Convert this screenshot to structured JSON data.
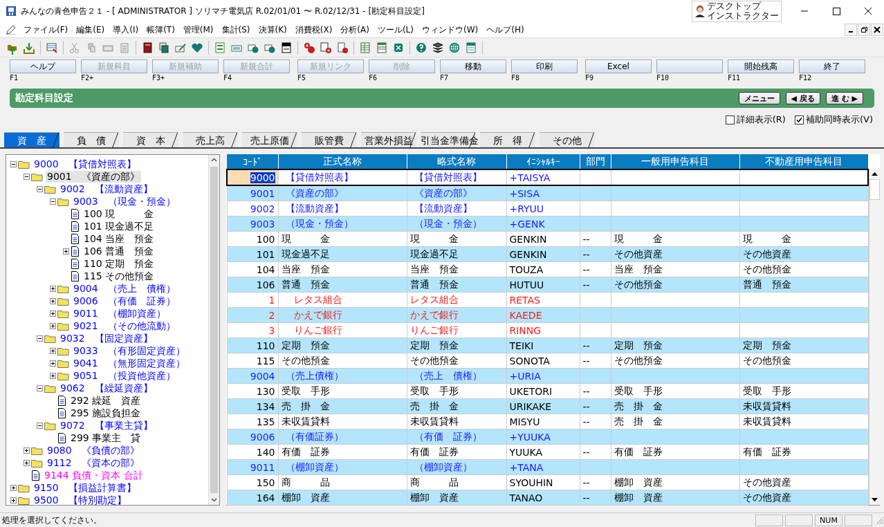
{
  "window": {
    "title": "みんなの青色申告２１ - [ ADMINISTRATOR ] ソリマチ電気店 R.02/01/01 〜 R.02/12/31 - [勘定科目設定]",
    "assistant_badge": [
      "デスクトップ",
      "インストラクター"
    ]
  },
  "menu": [
    "ファイル(F)",
    "編集(E)",
    "導入(I)",
    "帳簿(T)",
    "管理(M)",
    "集計(S)",
    "決算(K)",
    "消費税(X)",
    "分析(A)",
    "ツール(L)",
    "ウィンドウ(W)",
    "ヘルプ(H)"
  ],
  "function_keys": [
    {
      "label": "ヘルプ",
      "key": "F1",
      "disabled": false
    },
    {
      "label": "新規科目",
      "key": "F2+",
      "disabled": true
    },
    {
      "label": "新規補助",
      "key": "F3+",
      "disabled": true
    },
    {
      "label": "新規合計",
      "key": "F4",
      "disabled": true
    },
    {
      "label": "新規リンク",
      "key": "F5",
      "disabled": true
    },
    {
      "label": "削除",
      "key": "F6",
      "disabled": true
    },
    {
      "label": "移動",
      "key": "F7",
      "disabled": false
    },
    {
      "label": "印刷",
      "key": "F8",
      "disabled": false
    },
    {
      "label": "Excel",
      "key": "F9",
      "disabled": false
    },
    {
      "key": "F10"
    },
    {
      "label": "開始残高",
      "key": "F11",
      "disabled": false
    },
    {
      "label": "終了",
      "key": "F12",
      "disabled": false
    }
  ],
  "header": {
    "title": "勘定科目設定",
    "buttons": [
      "メニュー",
      "◀ 戻る",
      "進 む ▶"
    ]
  },
  "options": [
    {
      "label": "詳細表示(R)",
      "checked": false
    },
    {
      "label": "補助同時表示(V)",
      "checked": true
    }
  ],
  "tabs": [
    {
      "label": "資　産",
      "selected": true
    },
    {
      "label": "負　債",
      "selected": false
    },
    {
      "label": "資　本",
      "selected": false
    },
    {
      "label": "売上高",
      "selected": false
    },
    {
      "label": "売上原価",
      "selected": false
    },
    {
      "label": "販管費",
      "selected": false
    },
    {
      "label": "営業外損益",
      "selected": false
    },
    {
      "label": "引当金準備金",
      "selected": false
    },
    {
      "label": "所　得",
      "selected": false
    },
    {
      "label": "その他",
      "selected": false
    }
  ],
  "tree": [
    {
      "label": "9000　【貸借対照表】",
      "kind": "folder",
      "expanded": true,
      "color": "#0000ff",
      "selected": false,
      "children": [
        {
          "label": "9001　《資産の部》",
          "kind": "folder",
          "expanded": true,
          "color": "#000000",
          "selected": true,
          "children": [
            {
              "label": "9002　【流動資産】",
              "kind": "folder",
              "expanded": true,
              "color": "#0000ff",
              "selected": false,
              "children": [
                {
                  "label": "9003　（現金・預金）",
                  "kind": "folder",
                  "expanded": true,
                  "color": "#0000ff",
                  "selected": false,
                  "children": [
                    {
                      "label": "100 現　　　金",
                      "kind": "doc",
                      "color": "#000000",
                      "selected": false
                    },
                    {
                      "label": "101 現金過不足",
                      "kind": "doc",
                      "color": "#000000",
                      "selected": false
                    },
                    {
                      "label": "104 当座　預金",
                      "kind": "doc",
                      "color": "#000000",
                      "selected": false
                    },
                    {
                      "label": "106 普通　預金",
                      "kind": "doc",
                      "expanded": false,
                      "color": "#000000",
                      "selected": false
                    },
                    {
                      "label": "110 定期　預金",
                      "kind": "doc",
                      "color": "#000000",
                      "selected": false
                    },
                    {
                      "label": "115 その他預金",
                      "kind": "doc",
                      "color": "#000000",
                      "selected": false
                    }
                  ]
                },
                {
                  "label": "9004　（売上　債権）",
                  "kind": "folder",
                  "expanded": false,
                  "color": "#0000ff",
                  "selected": false
                },
                {
                  "label": "9006　（有価　証券）",
                  "kind": "folder",
                  "expanded": false,
                  "color": "#0000ff",
                  "selected": false
                },
                {
                  "label": "9011　（棚卸資産）",
                  "kind": "folder",
                  "expanded": false,
                  "color": "#0000ff",
                  "selected": false
                },
                {
                  "label": "9021　（その他流動）",
                  "kind": "folder",
                  "expanded": false,
                  "color": "#0000ff",
                  "selected": false
                }
              ]
            },
            {
              "label": "9032　【固定資産】",
              "kind": "folder",
              "expanded": true,
              "color": "#0000ff",
              "selected": false,
              "children": [
                {
                  "label": "9033　（有形固定資産）",
                  "kind": "folder",
                  "expanded": false,
                  "color": "#0000ff",
                  "selected": false
                },
                {
                  "label": "9041　（無形固定資産）",
                  "kind": "folder",
                  "expanded": false,
                  "color": "#0000ff",
                  "selected": false
                },
                {
                  "label": "9051　（投資他資産）",
                  "kind": "folder",
                  "expanded": false,
                  "color": "#0000ff",
                  "selected": false
                }
              ]
            },
            {
              "label": "9062　【繰延資産】",
              "kind": "folder",
              "expanded": true,
              "color": "#0000ff",
              "selected": false,
              "children": [
                {
                  "label": "292 繰延　資産",
                  "kind": "doc",
                  "color": "#000000",
                  "selected": false
                },
                {
                  "label": "295 施設負担金",
                  "kind": "doc",
                  "color": "#000000",
                  "selected": false
                }
              ]
            },
            {
              "label": "9072　【事業主貸】",
              "kind": "folder",
              "expanded": true,
              "color": "#0000ff",
              "selected": false,
              "children": [
                {
                  "label": "299 事業主　貸",
                  "kind": "doc",
                  "color": "#000000",
                  "selected": false
                }
              ]
            }
          ]
        },
        {
          "label": "9080　《負債の部》",
          "kind": "folder",
          "expanded": false,
          "color": "#0000ff",
          "selected": false
        },
        {
          "label": "9112　《資本の部》",
          "kind": "folder",
          "expanded": false,
          "color": "#0000ff",
          "selected": false
        },
        {
          "label": "9144 負債・資本 合計",
          "kind": "doc",
          "color": "#ff00ff",
          "selected": false
        }
      ]
    },
    {
      "label": "9150　【損益計算書】",
      "kind": "folder",
      "expanded": false,
      "color": "#0000ff",
      "selected": false
    },
    {
      "label": "9500　【特別勘定】",
      "kind": "folder",
      "expanded": false,
      "color": "#0000ff",
      "selected": false
    }
  ],
  "table": {
    "columns": [
      "ｺｰﾄﾞ",
      "正式名称",
      "略式名称",
      "ｲﾆｼｬﾙｷｰ",
      "部門",
      "一般用申告科目",
      "不動産用申告科目"
    ],
    "rows": [
      {
        "kind": "group",
        "selected": true,
        "cells": [
          "9000",
          "【貸借対照表】",
          "【貸借対照表】",
          "+TAISYA",
          "",
          "",
          ""
        ]
      },
      {
        "kind": "group",
        "selected": false,
        "cells": [
          "9001",
          "《資産の部》",
          "《資産の部》",
          "+SISA",
          "",
          "",
          ""
        ]
      },
      {
        "kind": "group",
        "selected": false,
        "cells": [
          "9002",
          "【流動資産】",
          "【流動資産】",
          "+RYUU",
          "",
          "",
          ""
        ]
      },
      {
        "kind": "group",
        "selected": false,
        "cells": [
          "9003",
          "（現金・預金）",
          "（現金・預金）",
          "+GENK",
          "",
          "",
          ""
        ]
      },
      {
        "kind": "account",
        "selected": false,
        "cells": [
          "100",
          "現　　　金",
          "現　　　金",
          "GENKIN",
          "--",
          "現　　　金",
          "現　　　金"
        ]
      },
      {
        "kind": "account",
        "selected": false,
        "cells": [
          "101",
          "現金過不足",
          "現金過不足",
          "GENKIN",
          "--",
          "その他資産",
          "その他資産"
        ]
      },
      {
        "kind": "account",
        "selected": false,
        "cells": [
          "104",
          "当座　預金",
          "当座　預金",
          "TOUZA",
          "--",
          "当座　預金",
          "その他預金"
        ]
      },
      {
        "kind": "account",
        "selected": false,
        "cells": [
          "106",
          "普通　預金",
          "普通　預金",
          "HUTUU",
          "--",
          "その他預金",
          "普通　預金"
        ]
      },
      {
        "kind": "sub",
        "selected": false,
        "cells": [
          "1",
          "レタス組合",
          "レタス組合",
          "RETAS",
          "",
          "",
          ""
        ]
      },
      {
        "kind": "sub",
        "selected": false,
        "cells": [
          "2",
          "かえで銀行",
          "かえで銀行",
          "KAEDE",
          "",
          "",
          ""
        ]
      },
      {
        "kind": "sub",
        "selected": false,
        "cells": [
          "3",
          "りんご銀行",
          "りんご銀行",
          "RINNG",
          "",
          "",
          ""
        ]
      },
      {
        "kind": "account",
        "selected": false,
        "cells": [
          "110",
          "定期　預金",
          "定期　預金",
          "TEIKI",
          "--",
          "定期　預金",
          "定期　預金"
        ]
      },
      {
        "kind": "account",
        "selected": false,
        "cells": [
          "115",
          "その他預金",
          "その他預金",
          "SONOTA",
          "--",
          "その他預金",
          "その他預金"
        ]
      },
      {
        "kind": "group",
        "selected": false,
        "cells": [
          "9004",
          "（売上債権）",
          "（売上　債権）",
          "+URIA",
          "",
          "",
          ""
        ]
      },
      {
        "kind": "account",
        "selected": false,
        "cells": [
          "130",
          "受取　手形",
          "受取　手形",
          "UKETORI",
          "--",
          "受取　手形",
          "受取　手形"
        ]
      },
      {
        "kind": "account",
        "selected": false,
        "cells": [
          "134",
          "売　掛　金",
          "売　掛　金",
          "URIKAKE",
          "--",
          "売　掛　金",
          "未収賃貸料"
        ]
      },
      {
        "kind": "account",
        "selected": false,
        "cells": [
          "135",
          "未収賃貸料",
          "未収賃貸料",
          "MISYU",
          "--",
          "売　掛　金",
          "未収賃貸料"
        ]
      },
      {
        "kind": "group",
        "selected": false,
        "cells": [
          "9006",
          "（有価証券）",
          "（有価　証券）",
          "+YUUKA",
          "",
          "",
          ""
        ]
      },
      {
        "kind": "account",
        "selected": false,
        "cells": [
          "140",
          "有価　証券",
          "有価　証券",
          "YUUKA",
          "--",
          "有価　証券",
          "有価　証券"
        ]
      },
      {
        "kind": "group",
        "selected": false,
        "cells": [
          "9011",
          "（棚卸資産）",
          "（棚卸資産）",
          "+TANA",
          "",
          "",
          ""
        ]
      },
      {
        "kind": "account",
        "selected": false,
        "cells": [
          "150",
          "商　　　品",
          "商　　　品",
          "SYOUHIN",
          "--",
          "棚卸　資産",
          "その他資産"
        ]
      },
      {
        "kind": "account",
        "selected": false,
        "cells": [
          "164",
          "棚卸　資産",
          "棚卸　資産",
          "TANAO",
          "--",
          "棚卸　資産",
          "その他資産"
        ]
      }
    ]
  },
  "status_bar": {
    "message": "処理を選択してください。",
    "indicator": "NUM"
  }
}
